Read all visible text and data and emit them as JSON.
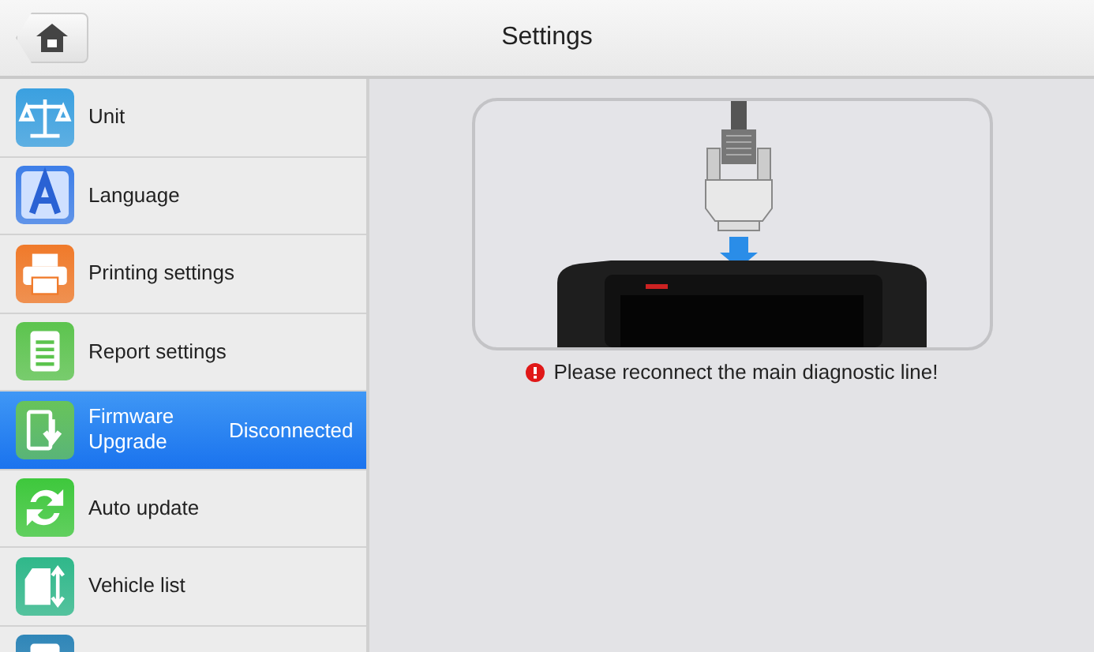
{
  "header": {
    "title": "Settings"
  },
  "sidebar": {
    "items": [
      {
        "label": "Unit",
        "selected": false
      },
      {
        "label": "Language",
        "selected": false
      },
      {
        "label": "Printing settings",
        "selected": false
      },
      {
        "label": "Report settings",
        "selected": false
      },
      {
        "label": "Firmware Upgrade",
        "status": "Disconnected",
        "selected": true
      },
      {
        "label": "Auto update",
        "selected": false
      },
      {
        "label": "Vehicle list",
        "selected": false
      },
      {
        "selected": false
      }
    ]
  },
  "content": {
    "message": "Please reconnect the main diagnostic line!"
  }
}
